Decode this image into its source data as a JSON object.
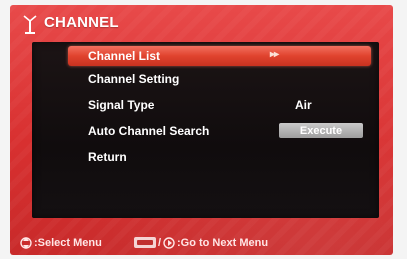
{
  "header": {
    "title": "CHANNEL",
    "icon": "antenna-icon"
  },
  "menu": {
    "items": [
      {
        "label": "Channel List",
        "value": "▸▸",
        "selected": true
      },
      {
        "label": "Channel Setting",
        "value": ""
      },
      {
        "label": "Signal Type",
        "value": "Air"
      },
      {
        "label": "Auto Channel Search",
        "button": "Execute"
      },
      {
        "label": "Return",
        "value": ""
      }
    ]
  },
  "footer": {
    "select_text": ":Select Menu",
    "slash": "/",
    "next_text": ":Go to Next Menu"
  },
  "colors": {
    "frame": "#e04040",
    "menu_bg": "#140f10",
    "highlight": "#e0432e",
    "button": "#b3b3b3"
  }
}
